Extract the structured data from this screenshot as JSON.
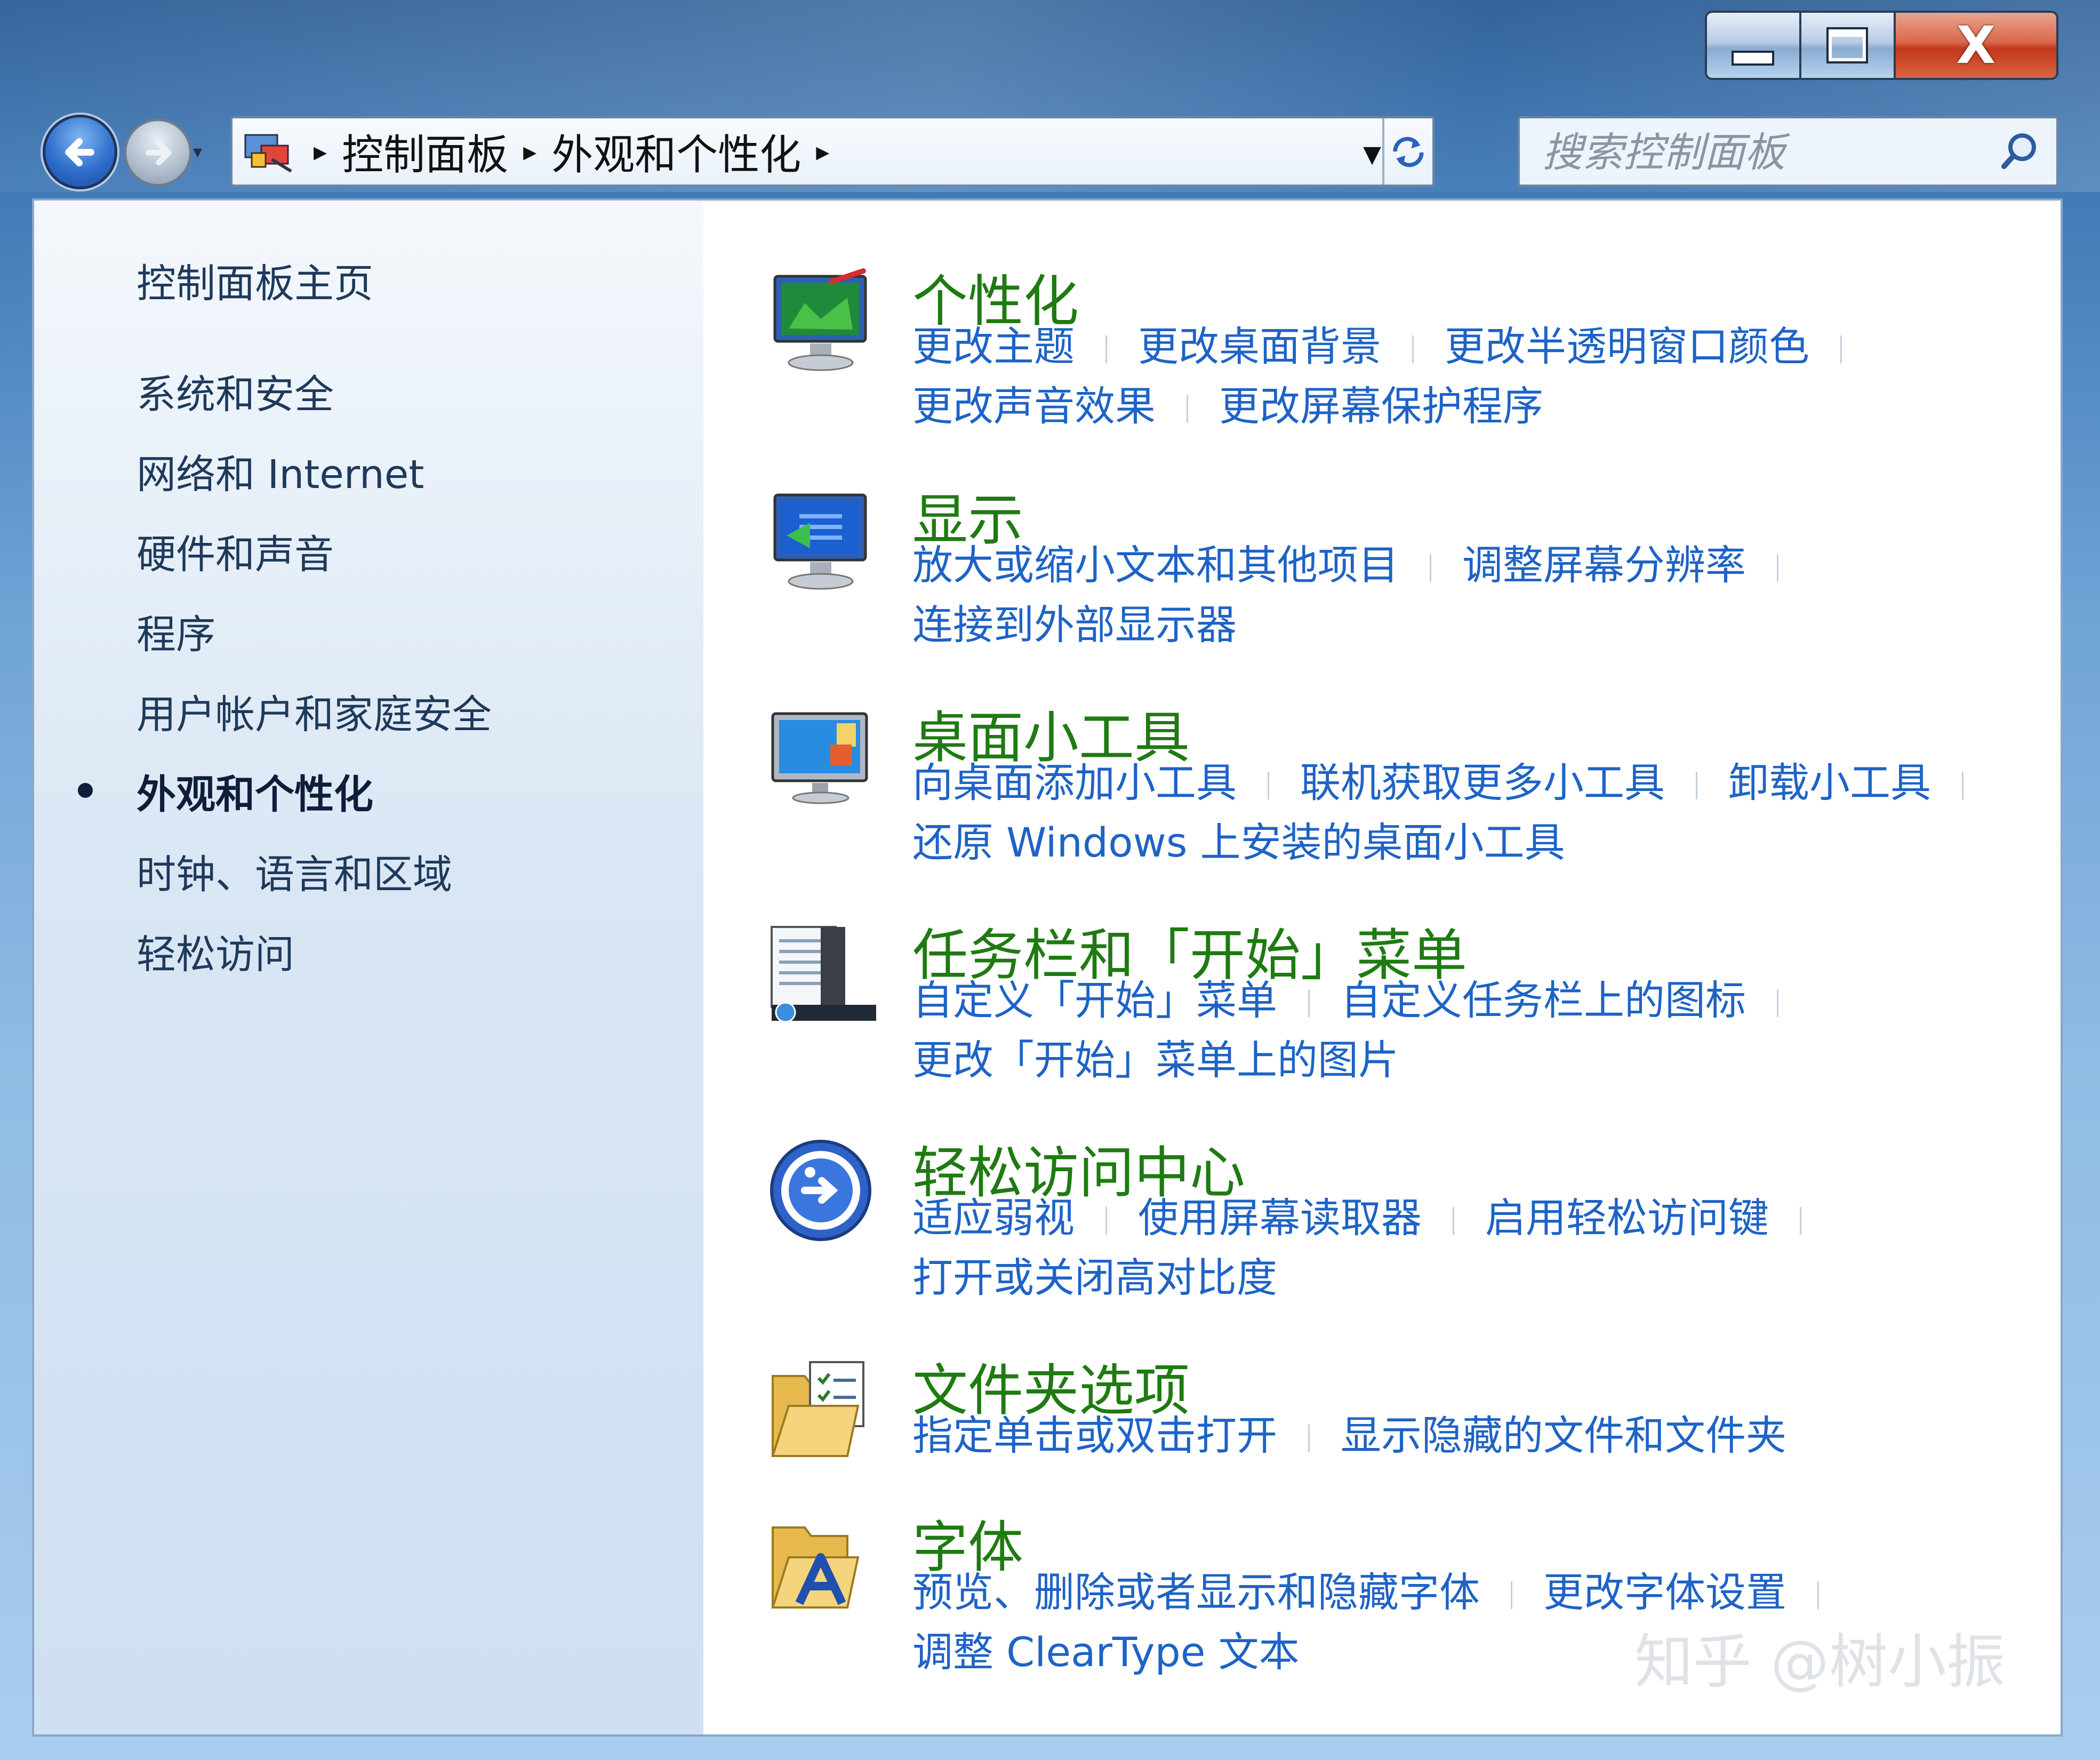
{
  "window": {
    "caption_buttons": {
      "minimize": "",
      "maximize": "",
      "close": "X"
    }
  },
  "address_bar": {
    "breadcrumbs": [
      "控制面板",
      "外观和个性化"
    ]
  },
  "search": {
    "placeholder": "搜索控制面板"
  },
  "sidebar": {
    "items": [
      {
        "label": "控制面板主页"
      },
      {
        "label": "系统和安全"
      },
      {
        "label": "网络和 Internet"
      },
      {
        "label": "硬件和声音"
      },
      {
        "label": "程序"
      },
      {
        "label": "用户帐户和家庭安全"
      },
      {
        "label": "外观和个性化",
        "active": true
      },
      {
        "label": "时钟、语言和区域"
      },
      {
        "label": "轻松访问"
      }
    ]
  },
  "categories": [
    {
      "title": "个性化",
      "icon": "personalization-icon",
      "rows": [
        [
          "更改主题",
          "更改桌面背景",
          "更改半透明窗口颜色"
        ],
        [
          "更改声音效果",
          "更改屏幕保护程序"
        ]
      ]
    },
    {
      "title": "显示",
      "icon": "display-icon",
      "rows": [
        [
          "放大或缩小文本和其他项目",
          "调整屏幕分辨率"
        ],
        [
          "连接到外部显示器"
        ]
      ]
    },
    {
      "title": "桌面小工具",
      "icon": "desktop-gadgets-icon",
      "rows": [
        [
          "向桌面添加小工具",
          "联机获取更多小工具",
          "卸载小工具"
        ],
        [
          "还原 Windows 上安装的桌面小工具"
        ]
      ]
    },
    {
      "title": "任务栏和「开始」菜单",
      "icon": "taskbar-start-menu-icon",
      "rows": [
        [
          "自定义「开始」菜单",
          "自定义任务栏上的图标"
        ],
        [
          "更改「开始」菜单上的图片"
        ]
      ]
    },
    {
      "title": "轻松访问中心",
      "icon": "ease-of-access-icon",
      "rows": [
        [
          "适应弱视",
          "使用屏幕读取器",
          "启用轻松访问键"
        ],
        [
          "打开或关闭高对比度"
        ]
      ]
    },
    {
      "title": "文件夹选项",
      "icon": "folder-options-icon",
      "rows": [
        [
          "指定单击或双击打开",
          "显示隐藏的文件和文件夹"
        ]
      ]
    },
    {
      "title": "字体",
      "icon": "fonts-folder-icon",
      "rows": [
        [
          "预览、删除或者显示和隐藏字体",
          "更改字体设置"
        ],
        [
          "调整 ClearType 文本"
        ]
      ]
    }
  ],
  "watermark": "知乎 @树小振",
  "colors": {
    "category_title": "#1f7a12",
    "link": "#1e63c6",
    "sidebar_text": "#1e395b"
  }
}
